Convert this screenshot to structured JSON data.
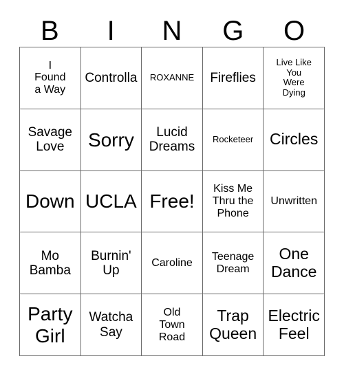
{
  "card": {
    "header_letters": [
      "B",
      "I",
      "N",
      "G",
      "O"
    ],
    "columns": 5,
    "rows": 5,
    "colors": {
      "background": "#ffffff",
      "text": "#000000",
      "grid_line": "#6b6b6b"
    },
    "cells": [
      {
        "text": "I\nFound\na Way",
        "size": "s",
        "free": false
      },
      {
        "text": "Controlla",
        "size": "m",
        "free": false
      },
      {
        "text": "ROXANNE",
        "size": "xs",
        "free": false
      },
      {
        "text": "Fireflies",
        "size": "m",
        "free": false
      },
      {
        "text": "Live Like\nYou\nWere\nDying",
        "size": "xs",
        "free": false
      },
      {
        "text": "Savage\nLove",
        "size": "m",
        "free": false
      },
      {
        "text": "Sorry",
        "size": "xl",
        "free": false
      },
      {
        "text": "Lucid\nDreams",
        "size": "m",
        "free": false
      },
      {
        "text": "Rocketeer",
        "size": "xs",
        "free": false
      },
      {
        "text": "Circles",
        "size": "l",
        "free": false
      },
      {
        "text": "Down",
        "size": "xl",
        "free": false
      },
      {
        "text": "UCLA",
        "size": "xl",
        "free": false
      },
      {
        "text": "Free!",
        "size": "xl",
        "free": true
      },
      {
        "text": "Kiss Me\nThru the\nPhone",
        "size": "s",
        "free": false
      },
      {
        "text": "Unwritten",
        "size": "s",
        "free": false
      },
      {
        "text": "Mo\nBamba",
        "size": "m",
        "free": false
      },
      {
        "text": "Burnin'\nUp",
        "size": "m",
        "free": false
      },
      {
        "text": "Caroline",
        "size": "s",
        "free": false
      },
      {
        "text": "Teenage\nDream",
        "size": "s",
        "free": false
      },
      {
        "text": "One\nDance",
        "size": "l",
        "free": false
      },
      {
        "text": "Party\nGirl",
        "size": "xl",
        "free": false
      },
      {
        "text": "Watcha\nSay",
        "size": "m",
        "free": false
      },
      {
        "text": "Old\nTown\nRoad",
        "size": "s",
        "free": false
      },
      {
        "text": "Trap\nQueen",
        "size": "l",
        "free": false
      },
      {
        "text": "Electric\nFeel",
        "size": "l",
        "free": false
      }
    ]
  }
}
